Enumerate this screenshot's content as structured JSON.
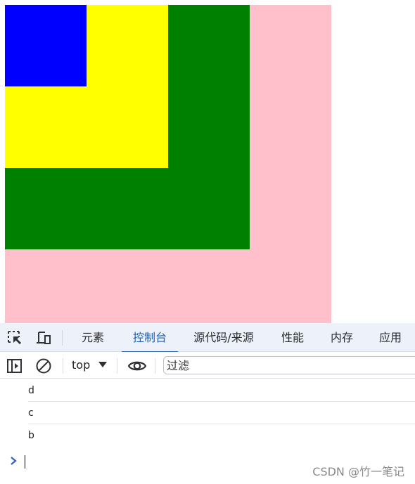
{
  "page": {
    "boxes": [
      {
        "id": "a",
        "color": "#ffc0cb"
      },
      {
        "id": "b",
        "color": "#008000"
      },
      {
        "id": "c",
        "color": "#ffff00"
      },
      {
        "id": "d",
        "color": "#0000ff"
      }
    ]
  },
  "devtools": {
    "icons": {
      "inspect": "inspect-element-icon",
      "device": "device-toolbar-icon",
      "sidebar": "show-sidebar-icon",
      "clear": "clear-console-icon",
      "dropdown": "chevron-down-icon",
      "eye": "live-expression-icon",
      "prompt": "chevron-right-icon"
    },
    "tabs": [
      {
        "label": "元素",
        "active": false
      },
      {
        "label": "控制台",
        "active": true
      },
      {
        "label": "源代码/来源",
        "active": false
      },
      {
        "label": "性能",
        "active": false
      },
      {
        "label": "内存",
        "active": false
      },
      {
        "label": "应用",
        "active": false
      }
    ],
    "toolbar": {
      "context": "top",
      "filter_placeholder": "过滤"
    },
    "console": {
      "messages": [
        "d",
        "c",
        "b"
      ],
      "input_value": ""
    },
    "accent_color": "#1a5fb4"
  },
  "watermark": "CSDN @竹一笔记"
}
